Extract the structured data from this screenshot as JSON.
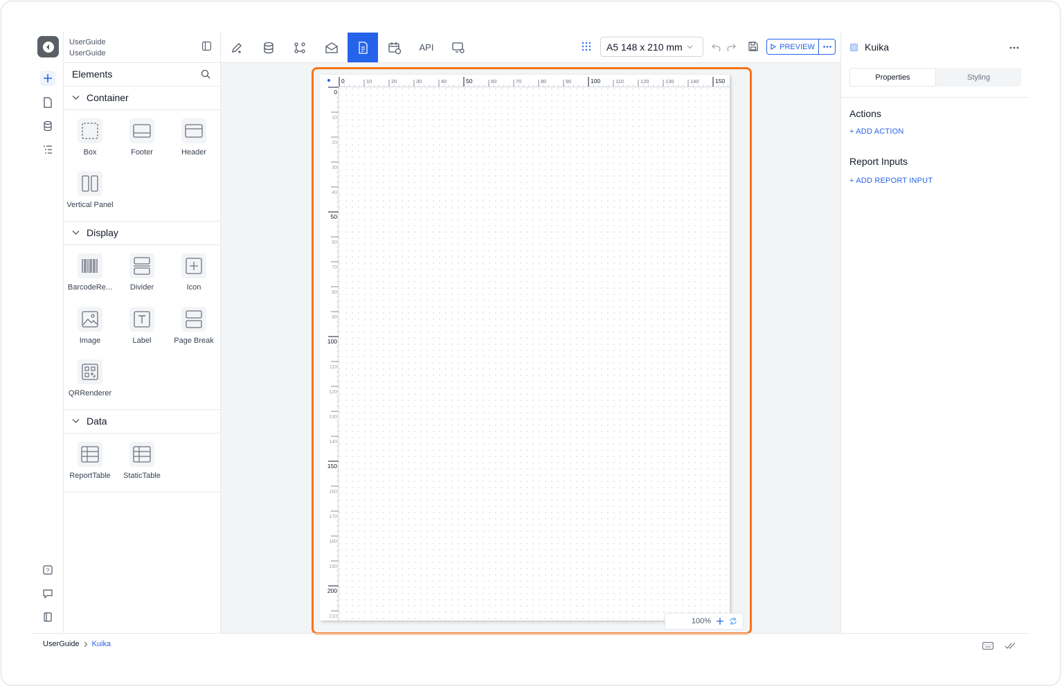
{
  "project": {
    "line1": "UserGuide",
    "line2": "UserGuide"
  },
  "rail": {
    "icons": [
      "plus-icon",
      "page-icon",
      "database-icon",
      "list-icon"
    ],
    "bottom_icons": [
      "help-icon",
      "chat-icon",
      "book-icon"
    ]
  },
  "elements": {
    "title": "Elements",
    "sections": [
      {
        "name": "Container",
        "items": [
          "Box",
          "Footer",
          "Header",
          "Vertical Panel"
        ]
      },
      {
        "name": "Display",
        "items": [
          "BarcodeRe...",
          "Divider",
          "Icon",
          "Image",
          "Label",
          "Page Break",
          "QRRenderer"
        ]
      },
      {
        "name": "Data",
        "items": [
          "ReportTable",
          "StaticTable"
        ]
      }
    ]
  },
  "toolbar": {
    "api_label": "API",
    "page_size": "A5 148 x 210 mm",
    "preview_label": "PREVIEW"
  },
  "ruler": {
    "h_major": [
      "0",
      "50",
      "100",
      "150"
    ],
    "h_minor": [
      "10",
      "20",
      "30",
      "40",
      "60",
      "70",
      "80",
      "90",
      "110",
      "120",
      "130",
      "140"
    ],
    "v_major": [
      "0",
      "50",
      "100",
      "150",
      "200"
    ],
    "v_minor": [
      "10",
      "20",
      "30",
      "40",
      "60",
      "70",
      "80",
      "90",
      "110",
      "120",
      "130",
      "140",
      "160",
      "170",
      "180",
      "190",
      "210"
    ]
  },
  "zoom": {
    "level": "100%"
  },
  "right_panel": {
    "title": "Kuika",
    "tabs": [
      "Properties",
      "Styling"
    ],
    "actions_heading": "Actions",
    "add_action": "+ ADD ACTION",
    "inputs_heading": "Report Inputs",
    "add_input": "+ ADD REPORT INPUT"
  },
  "breadcrumb": {
    "root": "UserGuide",
    "current": "Kuika"
  },
  "colors": {
    "accent": "#2563eb",
    "highlight": "#f97316"
  }
}
